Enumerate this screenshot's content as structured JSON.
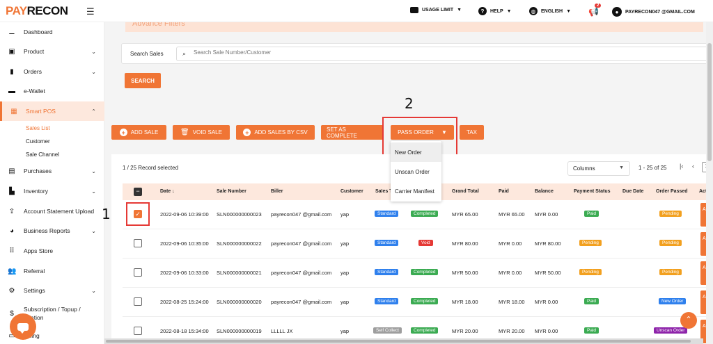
{
  "header": {
    "logo_pay": "PAY",
    "logo_recon": "RECON",
    "usage_limit": "USAGE LIMIT",
    "help": "HELP",
    "language": "ENGLISH",
    "notification_count": "2",
    "user_email": "PAYRECON047 @GMAIL.COM"
  },
  "sidebar": {
    "items": [
      {
        "label": "Dashboard",
        "icon": "chart-icon"
      },
      {
        "label": "Product",
        "icon": "box-icon"
      },
      {
        "label": "Orders",
        "icon": "clipboard-icon"
      },
      {
        "label": "e-Wallet",
        "icon": "wallet-icon"
      },
      {
        "label": "Smart POS",
        "icon": "pos-icon"
      },
      {
        "label": "Purchases",
        "icon": "cart-icon"
      },
      {
        "label": "Inventory",
        "icon": "warehouse-icon"
      },
      {
        "label": "Account Statement Upload",
        "icon": "upload-icon"
      },
      {
        "label": "Business Reports",
        "icon": "pie-icon"
      },
      {
        "label": "Apps Store",
        "icon": "grid-icon"
      },
      {
        "label": "Referral",
        "icon": "users-icon"
      },
      {
        "label": "Settings",
        "icon": "gear-icon"
      },
      {
        "label": "Subscription / Topup /",
        "label2": "ation",
        "icon": "dollar-icon"
      },
      {
        "label": "Billing",
        "icon": "billing-icon"
      }
    ],
    "sub_items": [
      "Sales List",
      "Customer",
      "Sale Channel"
    ]
  },
  "filters": {
    "advance_title": "Advance Filters",
    "search_label": "Search Sales",
    "search_placeholder": "Search Sale Number/Customer",
    "search_button": "SEARCH"
  },
  "annotations": {
    "step1": "1",
    "step2": "2"
  },
  "toolbar": {
    "add_sale": "ADD SALE",
    "void_sale": "VOID SALE",
    "add_csv": "ADD SALES BY CSV",
    "set_complete": "SET AS COMPLETE",
    "pass_order": "PASS ORDER",
    "tax": "TAX"
  },
  "pass_order_menu": [
    "New Order",
    "Unscan Order",
    "Carrier Manifest"
  ],
  "table": {
    "record_selected": "1 / 25 Record selected",
    "columns_label": "Columns",
    "pagination": "1 - 25 of 25",
    "page": "1",
    "headers": [
      "Date ↓",
      "Sale Number",
      "Biller",
      "Customer",
      "Sales Type",
      "Grand Total",
      "Paid",
      "Balance",
      "Payment Status",
      "Due Date",
      "Order Passed",
      "Actio"
    ],
    "action_label": "AC",
    "rows": [
      {
        "date": "2022-09-06 10:39:00",
        "sale": "SLN000000000023",
        "biller": "payrecon047 @gmail.com",
        "customer": "yap",
        "type": "Standard",
        "status": "Completed",
        "grand": "MYR 65.00",
        "paid": "MYR 65.00",
        "balance": "MYR 0.00",
        "payment": "Paid",
        "passed": "Pending"
      },
      {
        "date": "2022-09-06 10:35:00",
        "sale": "SLN000000000022",
        "biller": "payrecon047 @gmail.com",
        "customer": "yap",
        "type": "Standard",
        "status": "Void",
        "grand": "MYR 80.00",
        "paid": "MYR 0.00",
        "balance": "MYR 80.00",
        "payment": "Pending",
        "passed": "Pending"
      },
      {
        "date": "2022-09-06 10:33:00",
        "sale": "SLN000000000021",
        "biller": "payrecon047 @gmail.com",
        "customer": "yap",
        "type": "Standard",
        "status": "Completed",
        "grand": "MYR 50.00",
        "paid": "MYR 0.00",
        "balance": "MYR 50.00",
        "payment": "Pending",
        "passed": "Pending"
      },
      {
        "date": "2022-08-25 15:24:00",
        "sale": "SLN000000000020",
        "biller": "payrecon047 @gmail.com",
        "customer": "yap",
        "type": "Standard",
        "status": "Completed",
        "grand": "MYR 18.00",
        "paid": "MYR 18.00",
        "balance": "MYR 0.00",
        "payment": "Paid",
        "passed": "New Order"
      },
      {
        "date": "2022-08-18 15:34:00",
        "sale": "SLN000000000019",
        "biller": "LLLLL JX",
        "customer": "yap",
        "type": "Self Collect",
        "status": "Completed",
        "grand": "MYR 20.00",
        "paid": "MYR 20.00",
        "balance": "MYR 0.00",
        "payment": "Paid",
        "passed": "Unscan Order"
      }
    ]
  },
  "colors": {
    "accent": "#f07535",
    "highlight": "#e53935"
  }
}
